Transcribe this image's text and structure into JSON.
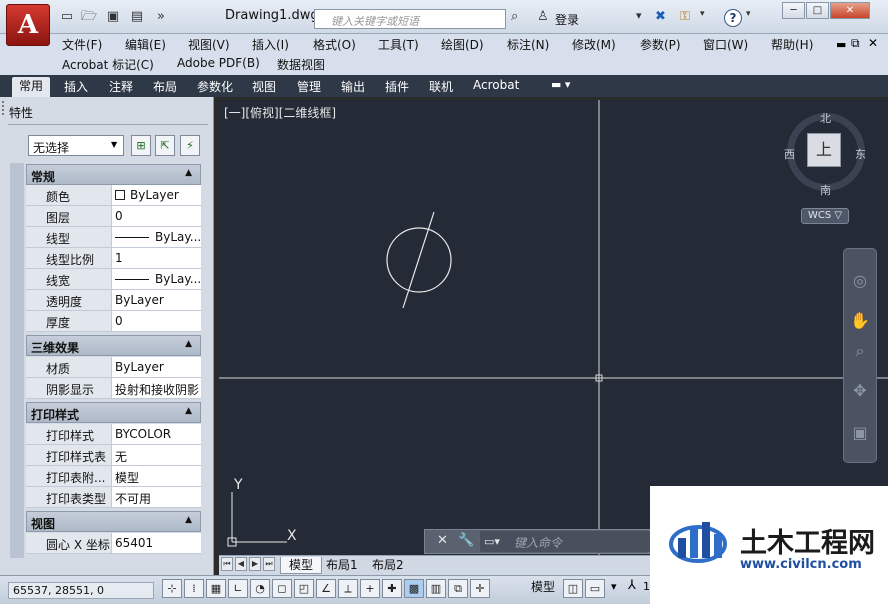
{
  "window": {
    "title": "Drawing1.dwg",
    "search_placeholder": "键入关键字或短语",
    "login": "登录",
    "help": "?",
    "controls": [
      "─",
      "□",
      "✕"
    ]
  },
  "app_logo": "A",
  "menu": {
    "row1": [
      "文件(F)",
      "编辑(E)",
      "视图(V)",
      "插入(I)",
      "格式(O)",
      "工具(T)",
      "绘图(D)",
      "标注(N)",
      "修改(M)",
      "参数(P)",
      "窗口(W)",
      "帮助(H)"
    ],
    "row2": [
      "Acrobat 标记(C)",
      "Adobe PDF(B)",
      "数据视图"
    ]
  },
  "ribbon_tabs": [
    "常用",
    "插入",
    "注释",
    "布局",
    "参数化",
    "视图",
    "管理",
    "输出",
    "插件",
    "联机",
    "Acrobat"
  ],
  "palette": {
    "title": "特性",
    "selection": "无选择",
    "sections": [
      {
        "title": "常规",
        "rows": [
          {
            "label": "颜色",
            "value": "ByLayer",
            "kind": "swatch"
          },
          {
            "label": "图层",
            "value": "0"
          },
          {
            "label": "线型",
            "value": "ByLay...",
            "kind": "line"
          },
          {
            "label": "线型比例",
            "value": "1"
          },
          {
            "label": "线宽",
            "value": "ByLay...",
            "kind": "line"
          },
          {
            "label": "透明度",
            "value": "ByLayer"
          },
          {
            "label": "厚度",
            "value": "0"
          }
        ]
      },
      {
        "title": "三维效果",
        "rows": [
          {
            "label": "材质",
            "value": "ByLayer"
          },
          {
            "label": "阴影显示",
            "value": "投射和接收阴影"
          }
        ]
      },
      {
        "title": "打印样式",
        "rows": [
          {
            "label": "打印样式",
            "value": "BYCOLOR"
          },
          {
            "label": "打印样式表",
            "value": "无"
          },
          {
            "label": "打印表附...",
            "value": "模型"
          },
          {
            "label": "打印表类型",
            "value": "不可用"
          }
        ]
      },
      {
        "title": "视图",
        "rows": [
          {
            "label": "圆心 X 坐标",
            "value": "65401"
          }
        ]
      }
    ]
  },
  "viewport": {
    "label": "[一][俯视][二维线框]",
    "compass": {
      "north": "北",
      "south": "南",
      "east": "东",
      "west": "西",
      "face": "上"
    },
    "wcs": "WCS ▽",
    "axis_x": "X",
    "axis_y": "Y"
  },
  "command": {
    "placeholder": "键入命令"
  },
  "layout_tabs": [
    "模型",
    "布局1",
    "布局2"
  ],
  "status": {
    "coords": "65537, 28551, 0",
    "model": "模型",
    "scale": "1"
  },
  "watermark": {
    "title": "土木工程网",
    "url": "www.civilcn.com"
  },
  "colors": {
    "canvas": "#252b36",
    "accent": "#1f4fa0",
    "logo_red": "#c1251c"
  }
}
